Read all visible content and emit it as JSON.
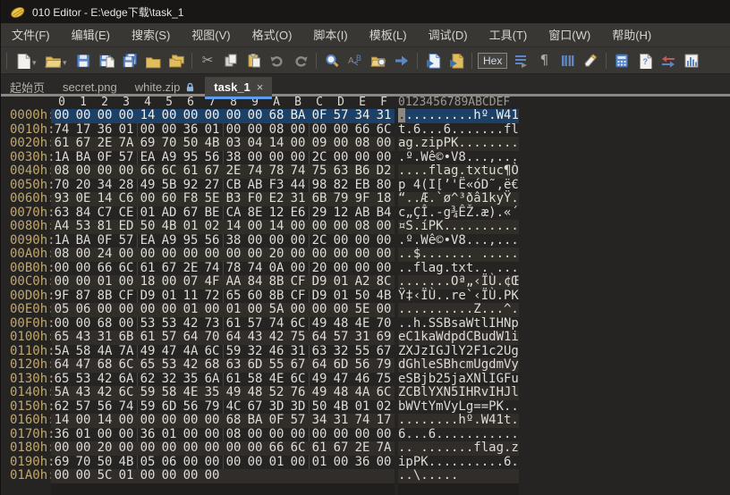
{
  "window": {
    "title": "010 Editor - E:\\edge下载\\task_1"
  },
  "menu": {
    "items": [
      "文件(F)",
      "编辑(E)",
      "搜索(S)",
      "视图(V)",
      "格式(O)",
      "脚本(I)",
      "模板(L)",
      "调试(D)",
      "工具(T)",
      "窗口(W)",
      "帮助(H)"
    ]
  },
  "toolbar": {
    "items": [
      {
        "name": "separator"
      },
      {
        "name": "new-file-icon",
        "caret": true
      },
      {
        "name": "open-file-icon",
        "caret": true
      },
      {
        "name": "save-icon"
      },
      {
        "name": "save-as-icon"
      },
      {
        "name": "save-all-icon"
      },
      {
        "name": "folder-icon"
      },
      {
        "name": "folders-icon"
      },
      {
        "name": "separator"
      },
      {
        "name": "cut-icon"
      },
      {
        "name": "copy-icon"
      },
      {
        "name": "paste-icon"
      },
      {
        "name": "undo-icon"
      },
      {
        "name": "redo-icon"
      },
      {
        "name": "separator"
      },
      {
        "name": "find-icon"
      },
      {
        "name": "replace-icon"
      },
      {
        "name": "find-in-files-icon"
      },
      {
        "name": "goto-icon"
      },
      {
        "name": "separator"
      },
      {
        "name": "run-script-icon"
      },
      {
        "name": "run-template-icon"
      },
      {
        "name": "separator"
      },
      {
        "name": "hex-mode-button",
        "label": "Hex",
        "active": true
      },
      {
        "name": "edit-as-icon"
      },
      {
        "name": "show-whitespace-icon",
        "glyph": "¶"
      },
      {
        "name": "column-mode-icon"
      },
      {
        "name": "highlight-icon"
      },
      {
        "name": "separator"
      },
      {
        "name": "calculator-icon"
      },
      {
        "name": "file-info-icon"
      },
      {
        "name": "compare-icon"
      },
      {
        "name": "histogram-icon"
      }
    ]
  },
  "tabs": [
    {
      "label": "起始页"
    },
    {
      "label": "secret.png"
    },
    {
      "label": "white.zip",
      "lock": true
    },
    {
      "label": "task_1",
      "active": true,
      "close": "×"
    }
  ],
  "hex": {
    "col_headers": [
      "0",
      "1",
      "2",
      "3",
      "4",
      "5",
      "6",
      "7",
      "8",
      "9",
      "A",
      "B",
      "C",
      "D",
      "E",
      "F"
    ],
    "ascii_header": "0123456789ABCDEF",
    "selected_row": 0,
    "rows": [
      {
        "addr": "0000h:",
        "bytes": [
          "00",
          "00",
          "00",
          "00",
          "14",
          "00",
          "00",
          "00",
          "00",
          "00",
          "68",
          "BA",
          "0F",
          "57",
          "34",
          "31"
        ],
        "ascii": "..........hº.W41"
      },
      {
        "addr": "0010h:",
        "bytes": [
          "74",
          "17",
          "36",
          "01",
          "00",
          "00",
          "36",
          "01",
          "00",
          "00",
          "08",
          "00",
          "00",
          "00",
          "66",
          "6C"
        ],
        "ascii": "t.6...6.......fl"
      },
      {
        "addr": "0020h:",
        "bytes": [
          "61",
          "67",
          "2E",
          "7A",
          "69",
          "70",
          "50",
          "4B",
          "03",
          "04",
          "14",
          "00",
          "09",
          "00",
          "08",
          "00"
        ],
        "ascii": "ag.zipPK........"
      },
      {
        "addr": "0030h:",
        "bytes": [
          "1A",
          "BA",
          "0F",
          "57",
          "EA",
          "A9",
          "95",
          "56",
          "38",
          "00",
          "00",
          "00",
          "2C",
          "00",
          "00",
          "00"
        ],
        "ascii": ".º.Wê©•V8...,..."
      },
      {
        "addr": "0040h:",
        "bytes": [
          "08",
          "00",
          "00",
          "00",
          "66",
          "6C",
          "61",
          "67",
          "2E",
          "74",
          "78",
          "74",
          "75",
          "63",
          "B6",
          "D2"
        ],
        "ascii": "....flag.txtuc¶Ò"
      },
      {
        "addr": "0050h:",
        "bytes": [
          "70",
          "20",
          "34",
          "28",
          "49",
          "5B",
          "92",
          "27",
          "CB",
          "AB",
          "F3",
          "44",
          "98",
          "82",
          "EB",
          "80"
        ],
        "ascii": "p 4(I[’'Ë«óD˜‚ë€"
      },
      {
        "addr": "0060h:",
        "bytes": [
          "93",
          "0E",
          "14",
          "C6",
          "00",
          "60",
          "F8",
          "5E",
          "B3",
          "F0",
          "E2",
          "31",
          "6B",
          "79",
          "9F",
          "18"
        ],
        "ascii": "“..Æ.`ø^³ðâ1kyŸ."
      },
      {
        "addr": "0070h:",
        "bytes": [
          "63",
          "84",
          "C7",
          "CE",
          "01",
          "AD",
          "67",
          "BE",
          "CA",
          "8E",
          "12",
          "E6",
          "29",
          "12",
          "AB",
          "B4"
        ],
        "ascii": "c„ÇÎ.-g¾ÊŽ.æ).«´"
      },
      {
        "addr": "0080h:",
        "bytes": [
          "A4",
          "53",
          "81",
          "ED",
          "50",
          "4B",
          "01",
          "02",
          "14",
          "00",
          "14",
          "00",
          "00",
          "00",
          "08",
          "00"
        ],
        "ascii": "¤S.íPK.........."
      },
      {
        "addr": "0090h:",
        "bytes": [
          "1A",
          "BA",
          "0F",
          "57",
          "EA",
          "A9",
          "95",
          "56",
          "38",
          "00",
          "00",
          "00",
          "2C",
          "00",
          "00",
          "00"
        ],
        "ascii": ".º.Wê©•V8...,..."
      },
      {
        "addr": "00A0h:",
        "bytes": [
          "08",
          "00",
          "24",
          "00",
          "00",
          "00",
          "00",
          "00",
          "00",
          "00",
          "20",
          "00",
          "00",
          "00",
          "00",
          "00"
        ],
        "ascii": "..$....... ....."
      },
      {
        "addr": "00B0h:",
        "bytes": [
          "00",
          "00",
          "66",
          "6C",
          "61",
          "67",
          "2E",
          "74",
          "78",
          "74",
          "0A",
          "00",
          "20",
          "00",
          "00",
          "00"
        ],
        "ascii": "..flag.txt.. ..."
      },
      {
        "addr": "00C0h:",
        "bytes": [
          "00",
          "00",
          "01",
          "00",
          "18",
          "00",
          "07",
          "4F",
          "AA",
          "84",
          "8B",
          "CF",
          "D9",
          "01",
          "A2",
          "8C"
        ],
        "ascii": ".......Oª„‹ÏÙ.¢Œ"
      },
      {
        "addr": "00D0h:",
        "bytes": [
          "9F",
          "87",
          "8B",
          "CF",
          "D9",
          "01",
          "11",
          "72",
          "65",
          "60",
          "8B",
          "CF",
          "D9",
          "01",
          "50",
          "4B"
        ],
        "ascii": "Ÿ‡‹ÏÙ..re`‹ÏÙ.PK"
      },
      {
        "addr": "00E0h:",
        "bytes": [
          "05",
          "06",
          "00",
          "00",
          "00",
          "00",
          "01",
          "00",
          "01",
          "00",
          "5A",
          "00",
          "00",
          "00",
          "5E",
          "00"
        ],
        "ascii": "..........Z...^."
      },
      {
        "addr": "00F0h:",
        "bytes": [
          "00",
          "00",
          "68",
          "00",
          "53",
          "53",
          "42",
          "73",
          "61",
          "57",
          "74",
          "6C",
          "49",
          "48",
          "4E",
          "70"
        ],
        "ascii": "..h.SSBsaWtlIHNp"
      },
      {
        "addr": "0100h:",
        "bytes": [
          "65",
          "43",
          "31",
          "6B",
          "61",
          "57",
          "64",
          "70",
          "64",
          "43",
          "42",
          "75",
          "64",
          "57",
          "31",
          "69"
        ],
        "ascii": "eC1kaWdpdCBudW1i"
      },
      {
        "addr": "0110h:",
        "bytes": [
          "5A",
          "58",
          "4A",
          "7A",
          "49",
          "47",
          "4A",
          "6C",
          "59",
          "32",
          "46",
          "31",
          "63",
          "32",
          "55",
          "67"
        ],
        "ascii": "ZXJzIGJlY2F1c2Ug"
      },
      {
        "addr": "0120h:",
        "bytes": [
          "64",
          "47",
          "68",
          "6C",
          "65",
          "53",
          "42",
          "68",
          "63",
          "6D",
          "55",
          "67",
          "64",
          "6D",
          "56",
          "79"
        ],
        "ascii": "dGhleSBhcmUgdmVy"
      },
      {
        "addr": "0130h:",
        "bytes": [
          "65",
          "53",
          "42",
          "6A",
          "62",
          "32",
          "35",
          "6A",
          "61",
          "58",
          "4E",
          "6C",
          "49",
          "47",
          "46",
          "75"
        ],
        "ascii": "eSBjb25jaXNlIGFu"
      },
      {
        "addr": "0140h:",
        "bytes": [
          "5A",
          "43",
          "42",
          "6C",
          "59",
          "58",
          "4E",
          "35",
          "49",
          "48",
          "52",
          "76",
          "49",
          "48",
          "4A",
          "6C"
        ],
        "ascii": "ZCBlYXN5IHRvIHJl"
      },
      {
        "addr": "0150h:",
        "bytes": [
          "62",
          "57",
          "56",
          "74",
          "59",
          "6D",
          "56",
          "79",
          "4C",
          "67",
          "3D",
          "3D",
          "50",
          "4B",
          "01",
          "02"
        ],
        "ascii": "bWVtYmVyLg==PK.."
      },
      {
        "addr": "0160h:",
        "bytes": [
          "14",
          "00",
          "14",
          "00",
          "00",
          "00",
          "00",
          "00",
          "68",
          "BA",
          "0F",
          "57",
          "34",
          "31",
          "74",
          "17"
        ],
        "ascii": "........hº.W41t."
      },
      {
        "addr": "0170h:",
        "bytes": [
          "36",
          "01",
          "00",
          "00",
          "36",
          "01",
          "00",
          "00",
          "08",
          "00",
          "00",
          "00",
          "00",
          "00",
          "00",
          "00"
        ],
        "ascii": "6...6..........."
      },
      {
        "addr": "0180h:",
        "bytes": [
          "00",
          "00",
          "20",
          "00",
          "00",
          "00",
          "00",
          "00",
          "00",
          "00",
          "66",
          "6C",
          "61",
          "67",
          "2E",
          "7A"
        ],
        "ascii": ".. .......flag.z"
      },
      {
        "addr": "0190h:",
        "bytes": [
          "69",
          "70",
          "50",
          "4B",
          "05",
          "06",
          "00",
          "00",
          "00",
          "00",
          "01",
          "00",
          "01",
          "00",
          "36",
          "00"
        ],
        "ascii": "ipPK..........6."
      },
      {
        "addr": "01A0h:",
        "bytes": [
          "00",
          "00",
          "5C",
          "01",
          "00",
          "00",
          "00",
          "00"
        ],
        "ascii": "..\\....."
      }
    ]
  },
  "colors": {
    "accent_blue": "#5e9ced",
    "selection": "#1d4066",
    "address_text": "#bfa76f",
    "icon_yellow": "#e0bd5f",
    "icon_blue": "#5b87c7"
  }
}
